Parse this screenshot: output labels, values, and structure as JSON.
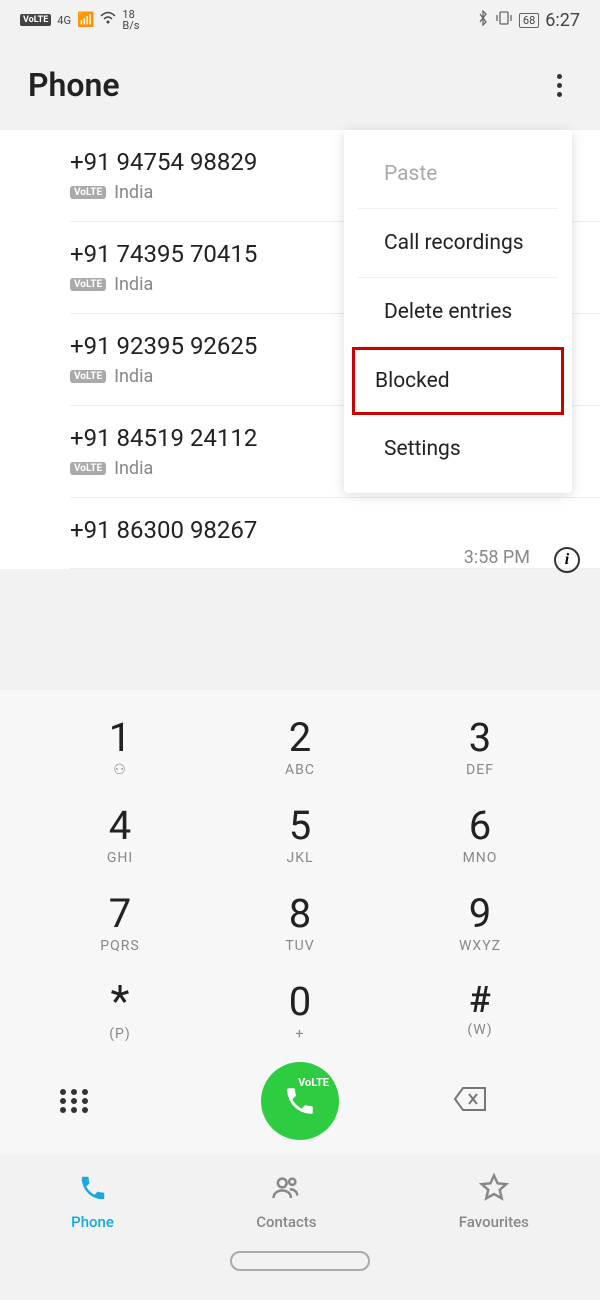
{
  "status": {
    "volte": "VoLTE",
    "network": "4G",
    "speed_top": "18",
    "speed_bottom": "B/s",
    "battery": "68",
    "time": "6:27"
  },
  "header": {
    "title": "Phone"
  },
  "menu": {
    "items": [
      {
        "label": "Paste",
        "disabled": true
      },
      {
        "label": "Call recordings"
      },
      {
        "label": "Delete entries"
      },
      {
        "label": "Blocked",
        "highlighted": true
      },
      {
        "label": "Settings"
      }
    ]
  },
  "calls": [
    {
      "number": "+91 94754 98829",
      "badge": "VoLTE",
      "country": "India"
    },
    {
      "number": "+91 74395 70415",
      "badge": "VoLTE",
      "country": "India"
    },
    {
      "number": "+91 92395 92625",
      "badge": "VoLTE",
      "country": "India"
    },
    {
      "number": "+91 84519 24112",
      "badge": "VoLTE",
      "country": "India"
    },
    {
      "number": "+91 86300 98267",
      "time": "3:58 PM",
      "info": true
    }
  ],
  "dialpad": {
    "keys": [
      [
        {
          "d": "1",
          "l": "⚇"
        },
        {
          "d": "2",
          "l": "ABC"
        },
        {
          "d": "3",
          "l": "DEF"
        }
      ],
      [
        {
          "d": "4",
          "l": "GHI"
        },
        {
          "d": "5",
          "l": "JKL"
        },
        {
          "d": "6",
          "l": "MNO"
        }
      ],
      [
        {
          "d": "7",
          "l": "PQRS"
        },
        {
          "d": "8",
          "l": "TUV"
        },
        {
          "d": "9",
          "l": "WXYZ"
        }
      ],
      [
        {
          "d": "*",
          "l": "(P)"
        },
        {
          "d": "0",
          "l": "+"
        },
        {
          "d": "#",
          "l": "(W)"
        }
      ]
    ],
    "call_label": "VoLTE"
  },
  "nav": {
    "items": [
      {
        "label": "Phone",
        "icon": "phone",
        "active": true
      },
      {
        "label": "Contacts",
        "icon": "contacts"
      },
      {
        "label": "Favourites",
        "icon": "star"
      }
    ]
  }
}
